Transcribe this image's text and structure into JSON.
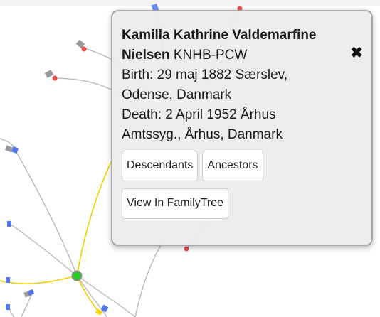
{
  "person": {
    "given_names": "Kamilla Kathrine Valdemarfine",
    "surname": "Nielsen",
    "id": "KNHB-PCW"
  },
  "birth": {
    "line1": "Birth: 29 maj 1882 Særslev,",
    "line2": "Odense, Danmark"
  },
  "death": {
    "line1": "Death: 2 April 1952 Århus",
    "line2": "Amtssyg., Århus, Danmark"
  },
  "buttons": {
    "descendants": "Descendants",
    "ancestors": "Ancestors",
    "view_in_familytree": "View In FamilyTree"
  },
  "icons": {
    "close": "close-icon"
  },
  "colors": {
    "female_node": "#e84b4b",
    "male_node": "#5577ee",
    "highlight_path": "#ffd700",
    "focus_node": "#22cc22",
    "edge": "#aaaaaa"
  }
}
